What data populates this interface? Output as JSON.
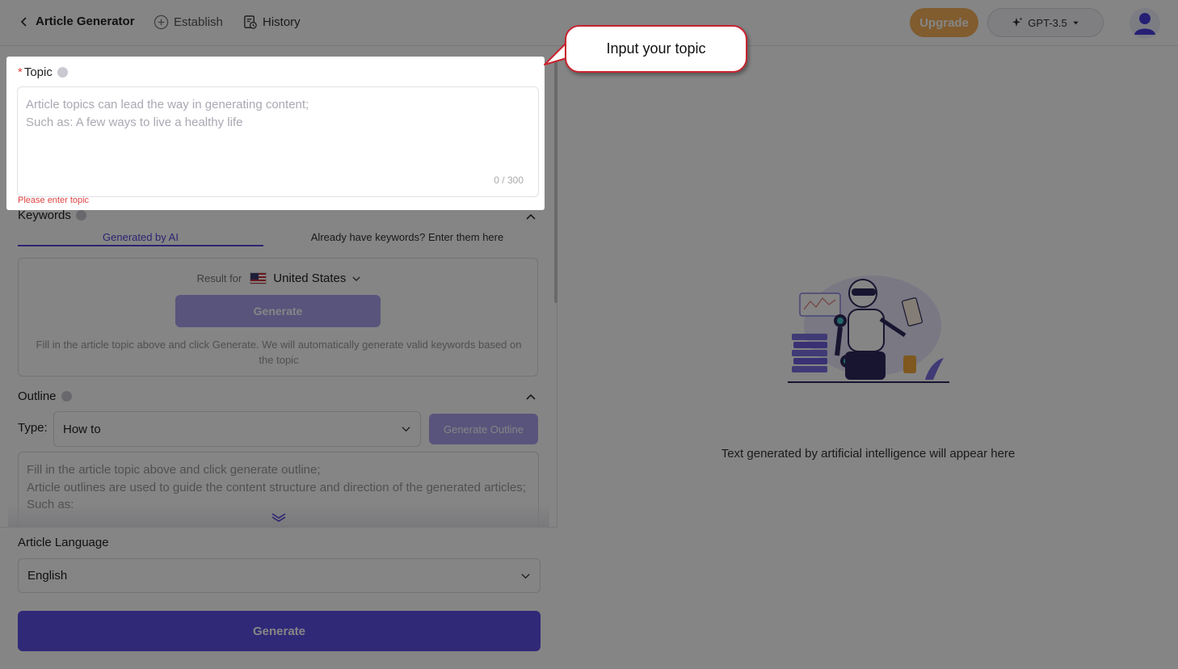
{
  "header": {
    "back_label": "Article Generator",
    "establish_label": "Establish",
    "history_label": "History",
    "upgrade_label": "Upgrade",
    "model_label": "GPT-3.5",
    "icons": {
      "back": "chevron-left-icon",
      "establish": "plus-circle-icon",
      "history": "history-document-icon",
      "model": "sparkle-icon",
      "model_caret": "caret-down-icon",
      "avatar": "user-icon"
    }
  },
  "topic": {
    "required_mark": "*",
    "title": "Topic",
    "placeholder_line1": "Article topics can lead the way in generating content;",
    "placeholder_line2": "Such as: A few ways to live a healthy life",
    "counter": "0 / 300",
    "error": "Please enter topic"
  },
  "keywords": {
    "title": "Keywords",
    "tab_ai": "Generated by AI",
    "tab_manual": "Already have keywords? Enter them here",
    "result_for": "Result for",
    "country": "United States",
    "generate_label": "Generate",
    "hint": "Fill in the article topic above and click Generate. We will automatically generate valid keywords based on the topic"
  },
  "outline": {
    "title": "Outline",
    "type_label": "Type:",
    "type_value": "How to",
    "generate_outline_label": "Generate Outline",
    "hint_line1": "Fill in the article topic above and click generate outline;",
    "hint_line2": "Article outlines are used to guide the content structure and direction of the generated articles;",
    "hint_line3": "Such as:"
  },
  "language": {
    "title": "Article Language",
    "value": "English"
  },
  "main_generate_label": "Generate",
  "preview": {
    "empty_text": "Text generated by artificial intelligence will appear here"
  },
  "callout": {
    "text": "Input your topic"
  },
  "colors": {
    "accent": "#5d4fe6",
    "accent_light": "#a9a1ee",
    "upgrade": "#f5b15a",
    "error": "#e04343",
    "callout_border": "#c8232f"
  }
}
